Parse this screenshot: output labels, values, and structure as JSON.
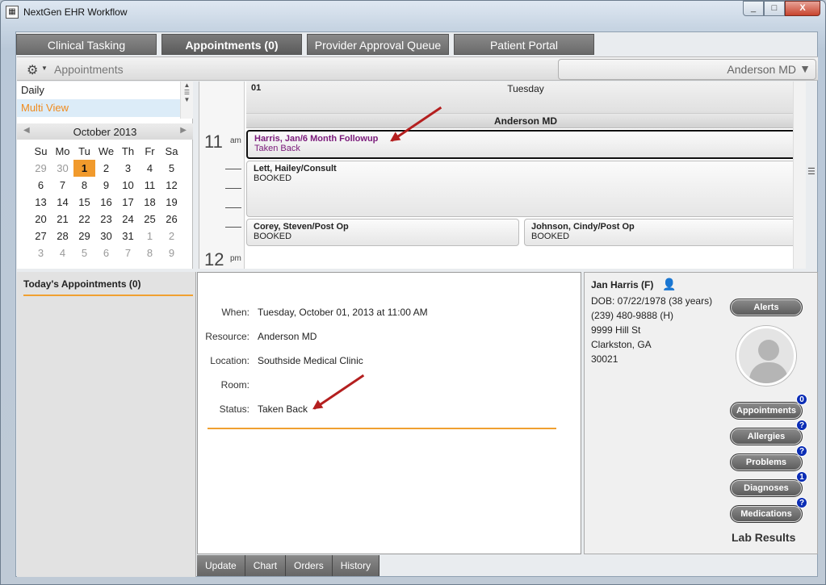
{
  "window": {
    "title": "NextGen EHR Workflow",
    "controls": [
      "_",
      "□",
      "X"
    ]
  },
  "tabs": [
    {
      "label": "Clinical Tasking"
    },
    {
      "label": "Appointments (0)"
    },
    {
      "label": "Provider Approval Queue"
    },
    {
      "label": "Patient Portal"
    }
  ],
  "toolbar": {
    "title": "Appointments",
    "provider": "Anderson MD"
  },
  "views": [
    {
      "label": "Daily"
    },
    {
      "label": "Multi View"
    }
  ],
  "calendar": {
    "month": "October 2013",
    "weekdays": [
      "Su",
      "Mo",
      "Tu",
      "We",
      "Th",
      "Fr",
      "Sa"
    ],
    "days": [
      "29",
      "30",
      "1",
      "2",
      "3",
      "4",
      "5",
      "6",
      "7",
      "8",
      "9",
      "10",
      "11",
      "12",
      "13",
      "14",
      "15",
      "16",
      "17",
      "18",
      "19",
      "20",
      "21",
      "22",
      "23",
      "24",
      "25",
      "26",
      "27",
      "28",
      "29",
      "30",
      "31",
      "1",
      "2",
      "3",
      "4",
      "5",
      "6",
      "7",
      "8",
      "9"
    ],
    "selected_index": 2
  },
  "schedule": {
    "day_number": "01",
    "day_name": "Tuesday",
    "resource": "Anderson MD",
    "hour1": "11",
    "ampm1": "am",
    "hour2": "12",
    "ampm2": "pm",
    "appointments": [
      {
        "name": "Harris, Jan/6 Month Followup",
        "status": "Taken Back"
      },
      {
        "name": "Lett, Hailey/Consult",
        "status": "BOOKED"
      },
      {
        "name": "Corey, Steven/Post Op",
        "status": "BOOKED"
      },
      {
        "name": "Johnson, Cindy/Post Op",
        "status": "BOOKED"
      }
    ]
  },
  "today": {
    "title": "Today's Appointments (0)"
  },
  "detail": {
    "when_label": "When:",
    "when": "Tuesday, October 01, 2013 at 11:00 AM",
    "resource_label": "Resource:",
    "resource": "Anderson MD",
    "location_label": "Location:",
    "location": "Southside Medical Clinic",
    "room_label": "Room:",
    "room": "",
    "status_label": "Status:",
    "status": "Taken Back"
  },
  "bottom_tabs": [
    {
      "label": "Update"
    },
    {
      "label": "Chart"
    },
    {
      "label": "Orders"
    },
    {
      "label": "History"
    }
  ],
  "patient": {
    "name": "Jan Harris (F)",
    "dob": "DOB: 07/22/1978 (38 years)",
    "phone": "(239) 480-9888 (H)",
    "address1": "9999 Hill St",
    "address2": "Clarkston, GA",
    "zip": "30021",
    "alerts": "Alerts",
    "buttons": [
      {
        "label": "Appointments",
        "badge": "0"
      },
      {
        "label": "Allergies",
        "badge": "?"
      },
      {
        "label": "Problems",
        "badge": "?"
      },
      {
        "label": "Diagnoses",
        "badge": "1"
      },
      {
        "label": "Medications",
        "badge": "?"
      }
    ],
    "lab_results": "Lab Results"
  },
  "colors": {
    "accent_orange": "#f0a030",
    "badge_blue": "#0b2db5",
    "arrow_red": "#b41f1f",
    "selected_appt": "#7a1a7a"
  }
}
